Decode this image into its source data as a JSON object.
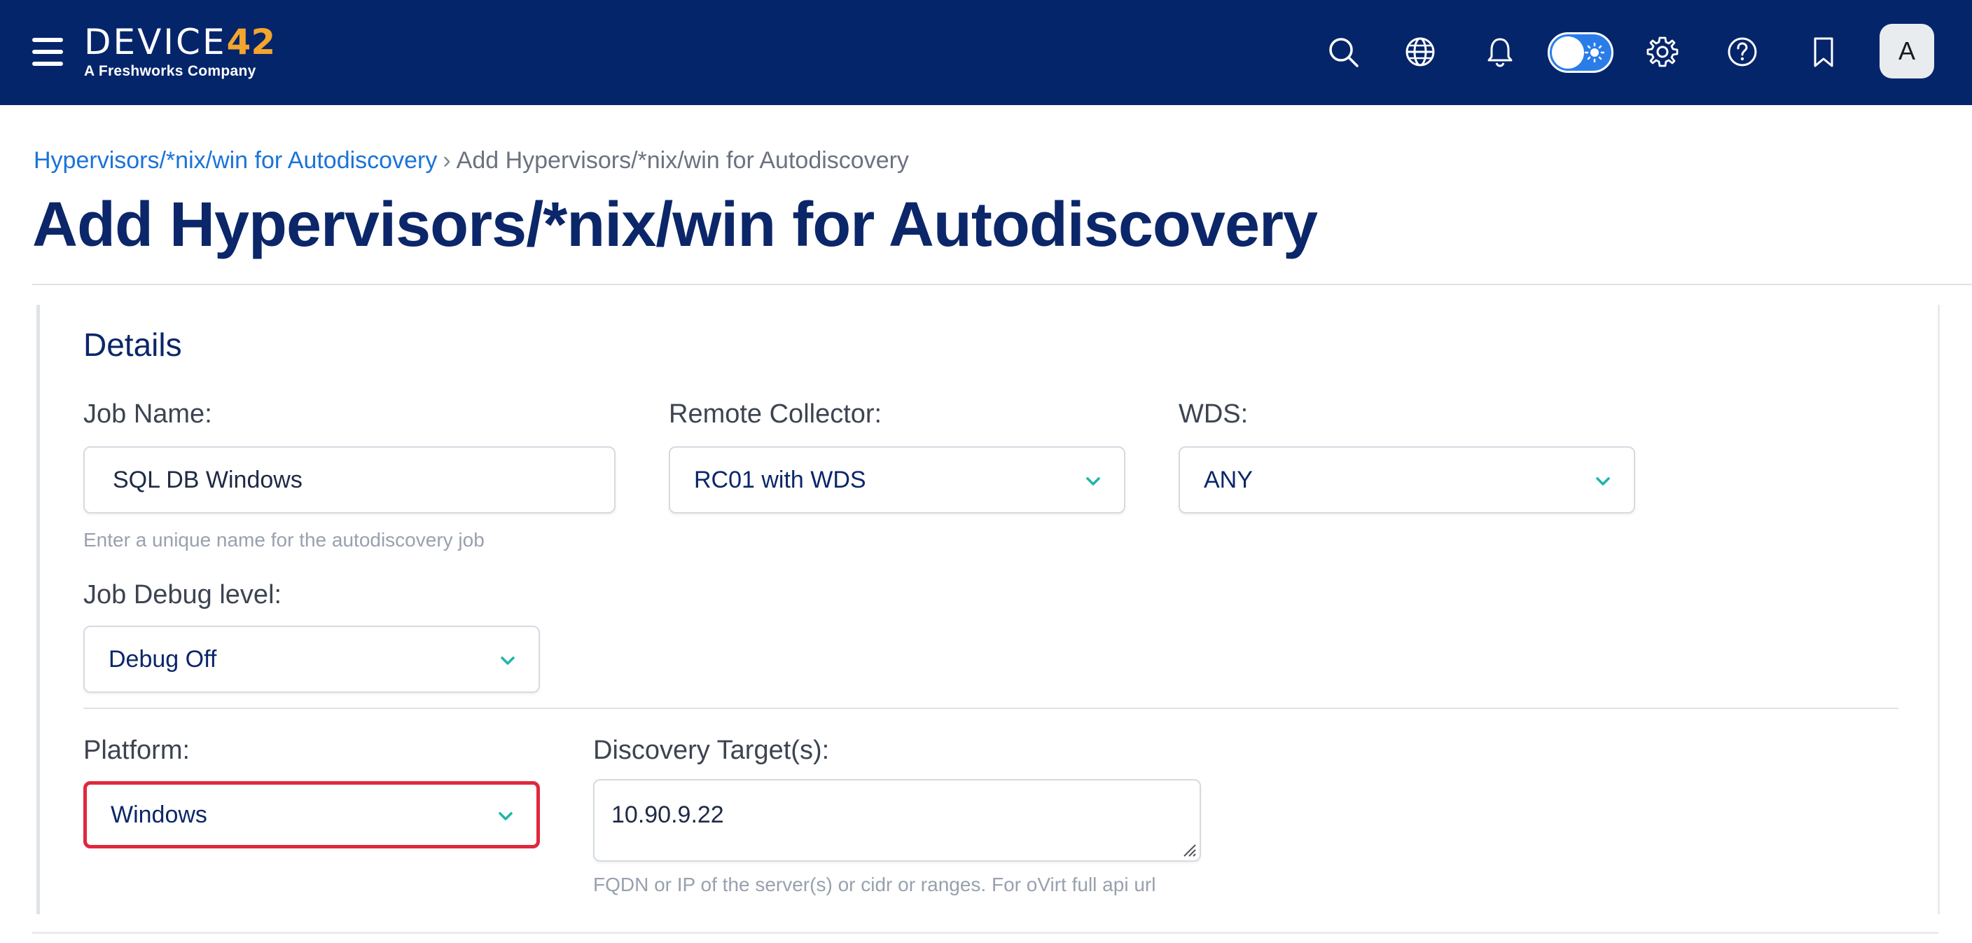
{
  "header": {
    "logo_text": "DEVICE",
    "logo_accent": "42",
    "logo_subtitle": "A Freshworks Company",
    "avatar_initial": "A",
    "bg_color": "#04256a",
    "icons": [
      "menu-icon",
      "search-icon",
      "globe-icon",
      "bell-icon",
      "theme-toggle",
      "gear-icon",
      "help-icon",
      "bookmark-icon"
    ]
  },
  "breadcrumb": {
    "parent": "Hypervisors/*nix/win for Autodiscovery",
    "separator": "›",
    "current": "Add Hypervisors/*nix/win for Autodiscovery"
  },
  "page_title": "Add Hypervisors/*nix/win for Autodiscovery",
  "details": {
    "section_title": "Details",
    "job_name": {
      "label": "Job Name:",
      "value": "SQL DB Windows",
      "help": "Enter a unique name for the autodiscovery job"
    },
    "remote_collector": {
      "label": "Remote Collector:",
      "value": "RC01 with WDS"
    },
    "wds": {
      "label": "WDS:",
      "value": "ANY"
    },
    "job_debug_level": {
      "label": "Job Debug level:",
      "value": "Debug Off"
    },
    "platform": {
      "label": "Platform:",
      "value": "Windows",
      "highlight_color": "#e0283c"
    },
    "discovery_targets": {
      "label": "Discovery Target(s):",
      "value": "10.90.9.22",
      "help": "FQDN or IP of the server(s) or cidr or ranges. For oVirt full api url"
    }
  },
  "colors": {
    "title": "#0b2769",
    "link": "#1a73d9",
    "chevron": "#1fb5a8",
    "toggle": "#2a7de8",
    "logo_accent": "#f3a52e"
  }
}
